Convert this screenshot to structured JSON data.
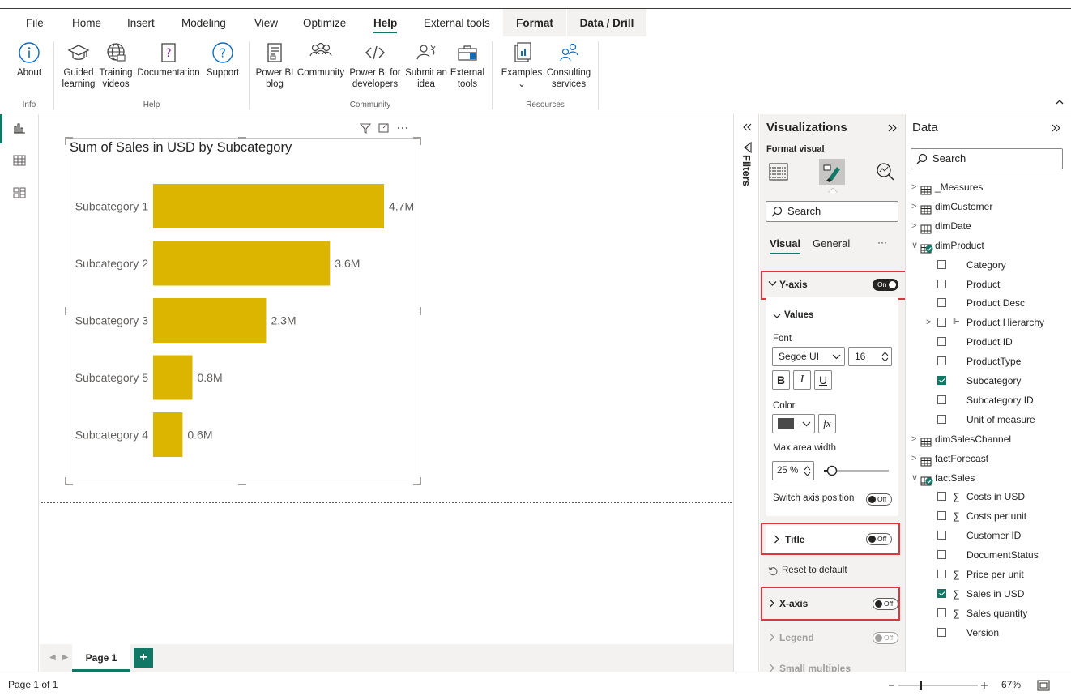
{
  "ribbon_tabs": [
    "File",
    "Home",
    "Insert",
    "Modeling",
    "View",
    "Optimize",
    "Help",
    "External tools",
    "Format",
    "Data / Drill"
  ],
  "active_tab": "Help",
  "ribbon": {
    "info": {
      "about": "About",
      "group": "Info"
    },
    "help": {
      "guided1": "Guided",
      "guided2": "learning",
      "training1": "Training",
      "training2": "videos",
      "documentation": "Documentation",
      "support": "Support",
      "group": "Help"
    },
    "community": {
      "blog1": "Power BI",
      "blog2": "blog",
      "community": "Community",
      "dev1": "Power BI for",
      "dev2": "developers",
      "submit1": "Submit an",
      "submit2": "idea",
      "external1": "External",
      "external2": "tools",
      "group": "Community"
    },
    "resources": {
      "examples": "Examples",
      "examples_chev": "⌄",
      "consulting1": "Consulting",
      "consulting2": "services",
      "group": "Resources"
    }
  },
  "visual": {
    "title": "Sum of Sales in USD by Subcategory"
  },
  "chart_data": {
    "type": "bar",
    "orientation": "horizontal",
    "title": "Sum of Sales in USD by Subcategory",
    "categories": [
      "Subcategory 1",
      "Subcategory 2",
      "Subcategory 3",
      "Subcategory 5",
      "Subcategory 4"
    ],
    "values": [
      4.7,
      3.6,
      2.3,
      0.8,
      0.6
    ],
    "data_labels": [
      "4.7M",
      "3.6M",
      "2.3M",
      "0.8M",
      "0.6M"
    ],
    "bar_color": "#dbb500",
    "xlim": [
      0,
      4.7
    ]
  },
  "page_tabs": {
    "page1": "Page 1",
    "add": "+"
  },
  "status": {
    "page": "Page 1 of 1",
    "zoom": "67%",
    "zoom_level": 0.67
  },
  "filters": {
    "label": "Filters"
  },
  "viz": {
    "title": "Visualizations",
    "format_visual": "Format visual",
    "search_placeholder": "Search",
    "tab_visual": "Visual",
    "tab_general": "General",
    "more": "···",
    "yaxis": "Y-axis",
    "yaxis_state": "On",
    "values": "Values",
    "font_label": "Font",
    "font_family": "Segoe UI",
    "font_size": "16",
    "bold": "B",
    "italic": "I",
    "underline": "U",
    "color_label": "Color",
    "color_value": "#4a4a4a",
    "fx": "fx",
    "max_area_label": "Max area width",
    "max_area_value": "25 %",
    "max_area_fraction": 0.25,
    "switch_axis": "Switch axis position",
    "switch_axis_state": "Off",
    "title_section": "Title",
    "title_state": "Off",
    "reset": "Reset to default",
    "xaxis": "X-axis",
    "xaxis_state": "Off",
    "legend": "Legend",
    "legend_state": "Off",
    "small_multiples": "Small multiples"
  },
  "data": {
    "title": "Data",
    "search_placeholder": "Search",
    "items": [
      {
        "label": "_Measures",
        "kind": "table",
        "level": 0
      },
      {
        "label": "dimCustomer",
        "kind": "table",
        "level": 0
      },
      {
        "label": "dimDate",
        "kind": "table",
        "level": 0
      },
      {
        "label": "dimProduct",
        "kind": "table-open",
        "level": 0
      },
      {
        "label": "Category",
        "kind": "field",
        "level": 1,
        "checked": false
      },
      {
        "label": "Product",
        "kind": "field",
        "level": 1,
        "checked": false
      },
      {
        "label": "Product Desc",
        "kind": "field",
        "level": 1,
        "checked": false
      },
      {
        "label": "Product Hierarchy",
        "kind": "hierarchy",
        "level": 1,
        "checked": false
      },
      {
        "label": "Product ID",
        "kind": "field",
        "level": 1,
        "checked": false
      },
      {
        "label": "ProductType",
        "kind": "field",
        "level": 1,
        "checked": false
      },
      {
        "label": "Subcategory",
        "kind": "field",
        "level": 1,
        "checked": true
      },
      {
        "label": "Subcategory ID",
        "kind": "field",
        "level": 1,
        "checked": false
      },
      {
        "label": "Unit of measure",
        "kind": "field",
        "level": 1,
        "checked": false
      },
      {
        "label": "dimSalesChannel",
        "kind": "table",
        "level": 0
      },
      {
        "label": "factForecast",
        "kind": "table",
        "level": 0
      },
      {
        "label": "factSales",
        "kind": "table-open",
        "level": 0
      },
      {
        "label": "Costs in USD",
        "kind": "measure",
        "level": 1,
        "checked": false
      },
      {
        "label": "Costs per unit",
        "kind": "measure",
        "level": 1,
        "checked": false
      },
      {
        "label": "Customer ID",
        "kind": "field",
        "level": 1,
        "checked": false
      },
      {
        "label": "DocumentStatus",
        "kind": "field",
        "level": 1,
        "checked": false
      },
      {
        "label": "Price per unit",
        "kind": "measure",
        "level": 1,
        "checked": false
      },
      {
        "label": "Sales in USD",
        "kind": "measure",
        "level": 1,
        "checked": true
      },
      {
        "label": "Sales quantity",
        "kind": "measure",
        "level": 1,
        "checked": false
      },
      {
        "label": "Version",
        "kind": "field",
        "level": 1,
        "checked": false
      }
    ]
  }
}
